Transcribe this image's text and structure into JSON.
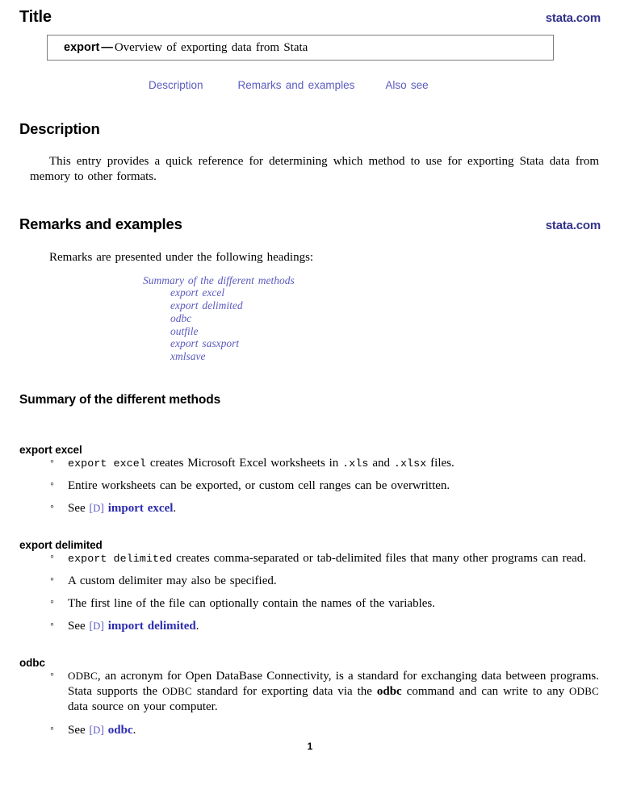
{
  "header": {
    "title": "Title",
    "stata_link": "stata.com"
  },
  "title_box": {
    "command": "export",
    "dash": "—",
    "description": "Overview of exporting data from Stata"
  },
  "nav": {
    "items": [
      {
        "label": "Description"
      },
      {
        "label": "Remarks and examples"
      },
      {
        "label": "Also see"
      }
    ]
  },
  "description": {
    "heading": "Description",
    "paragraph": "This entry provides a quick reference for determining which method to use for exporting Stata data from memory to other formats."
  },
  "remarks": {
    "heading": "Remarks and examples",
    "stata_link": "stata.com",
    "intro": "Remarks are presented under the following headings:",
    "toc": [
      {
        "label": "Summary of the different methods",
        "level": 1
      },
      {
        "label": "export excel",
        "level": 2
      },
      {
        "label": "export delimited",
        "level": 2
      },
      {
        "label": "odbc",
        "level": 2
      },
      {
        "label": "outfile",
        "level": 2
      },
      {
        "label": "export sasxport",
        "level": 2
      },
      {
        "label": "xmlsave",
        "level": 2
      }
    ]
  },
  "summary": {
    "heading": "Summary of the different methods"
  },
  "export_excel": {
    "heading": "export excel",
    "bullets": {
      "b1": {
        "cmd": "export excel",
        "text_a": "creates Microsoft Excel worksheets in",
        "ext1": ".xls",
        "text_b": "and",
        "ext2": ".xlsx",
        "text_c": "files."
      },
      "b2": {
        "text": "Entire worksheets can be exported, or custom cell ranges can be overwritten."
      },
      "b3": {
        "see": "See",
        "bracket_open": "[",
        "bracket_letter": "D",
        "bracket_close": "]",
        "ref": "import excel",
        "period": "."
      }
    }
  },
  "export_delimited": {
    "heading": "export delimited",
    "bullets": {
      "b1": {
        "cmd": "export delimited",
        "text": "creates comma-separated or tab-delimited files that many other programs can read."
      },
      "b2": {
        "text": "A custom delimiter may also be specified."
      },
      "b3": {
        "text": "The first line of the file can optionally contain the names of the variables."
      },
      "b4": {
        "see": "See",
        "bracket_open": "[",
        "bracket_letter": "D",
        "bracket_close": "]",
        "ref": "import delimited",
        "period": "."
      }
    }
  },
  "odbc": {
    "heading": "odbc",
    "bullets": {
      "b1": {
        "acronym1": "ODBC",
        "text_a": ", an acronym for Open DataBase Connectivity, is a standard for exchanging data between programs. Stata supports the",
        "acronym2": "ODBC",
        "text_b": "standard for exporting data via the",
        "cmd": "odbc",
        "text_c": "command and can write to any",
        "acronym3": "ODBC",
        "text_d": "data source on your computer."
      },
      "b2": {
        "see": "See",
        "bracket_open": "[",
        "bracket_letter": "D",
        "bracket_close": "]",
        "ref": "odbc",
        "period": "."
      }
    }
  },
  "footer": {
    "page_number": "1"
  },
  "colors": {
    "stata_link": "#32328c",
    "nav_link": "#5b5bc0",
    "toc_link": "#5b5bc0",
    "ref_link": "#2b2bb0",
    "box_border": "#7d7d7d",
    "text": "#000000"
  }
}
